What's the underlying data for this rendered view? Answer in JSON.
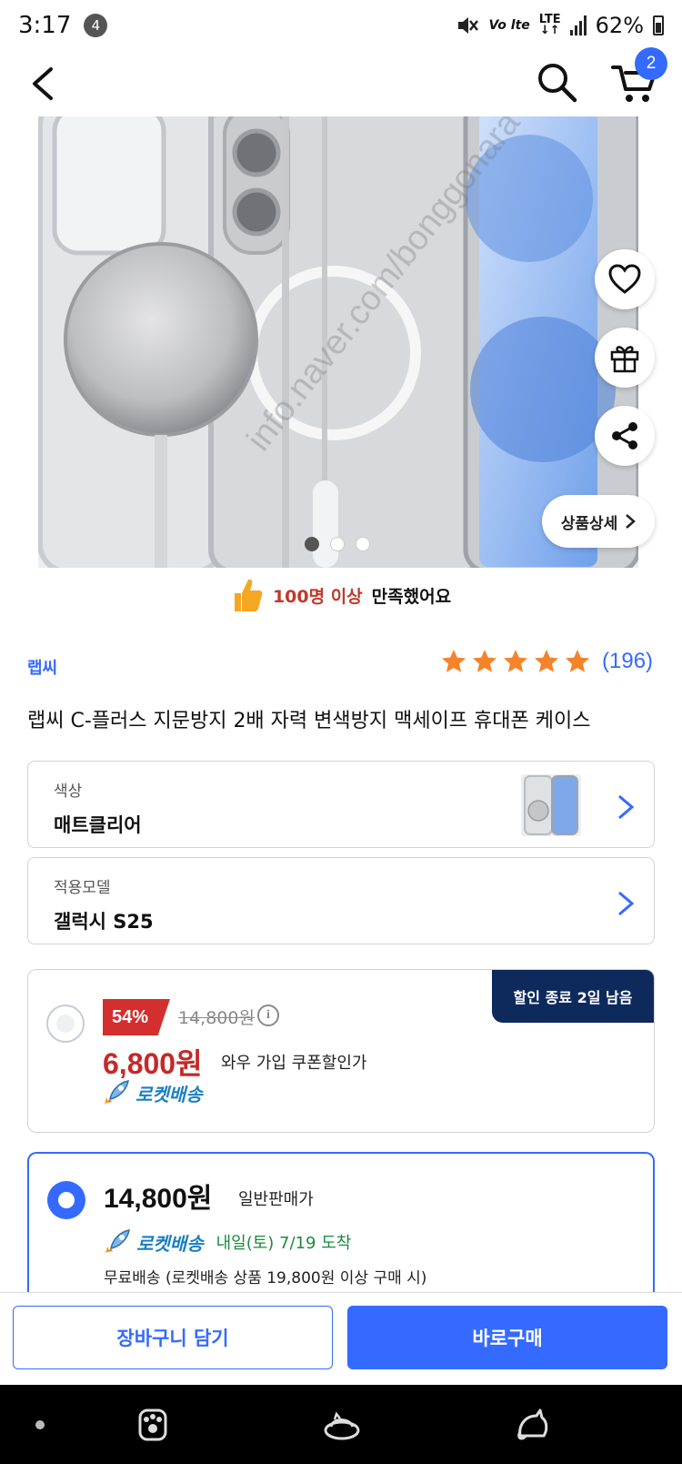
{
  "status_bar": {
    "time": "3:17",
    "notification_count": "4",
    "volte": "Vo lte",
    "lte": "LTE",
    "battery": "62%"
  },
  "header": {
    "cart_count": "2"
  },
  "hero": {
    "watermark": "info.naver.com/bonggonara",
    "detail_button": "상품상세",
    "page_total": 3,
    "page_current": 1
  },
  "satisfaction": {
    "highlight": "100명 이상",
    "rest": "만족했어요"
  },
  "product": {
    "brand": "랩씨",
    "rating": 5,
    "review_count": "(196)",
    "title": "랩씨 C-플러스 지문방지 2배 자력 변색방지 맥세이프 휴대폰 케이스"
  },
  "options": [
    {
      "label": "색상",
      "value": "매트클리어"
    },
    {
      "label": "적용모델",
      "value": "갤럭시 S25"
    }
  ],
  "price_option_1": {
    "end_tag": "할인 종료 2일 남음",
    "discount": "54%",
    "original_price": "14,800원",
    "info": "i",
    "sale_price": "6,800원",
    "coupon_text": "와우 가입 쿠폰할인가",
    "delivery": "로켓배송"
  },
  "price_option_2": {
    "price": "14,800원",
    "seller_type": "일반판매가",
    "delivery": "로켓배송",
    "eta": "내일(토) 7/19 도착",
    "free_shipping": "무료배송 (로켓배송 상품 19,800원 이상 구매 시)"
  },
  "actions": {
    "add_to_cart": "장바구니 담기",
    "buy_now": "바로구매"
  },
  "colors": {
    "accent": "#346aff",
    "sale_red": "#c62828",
    "star": "#f5832a",
    "end_tag_bg": "#0e2a5c"
  }
}
